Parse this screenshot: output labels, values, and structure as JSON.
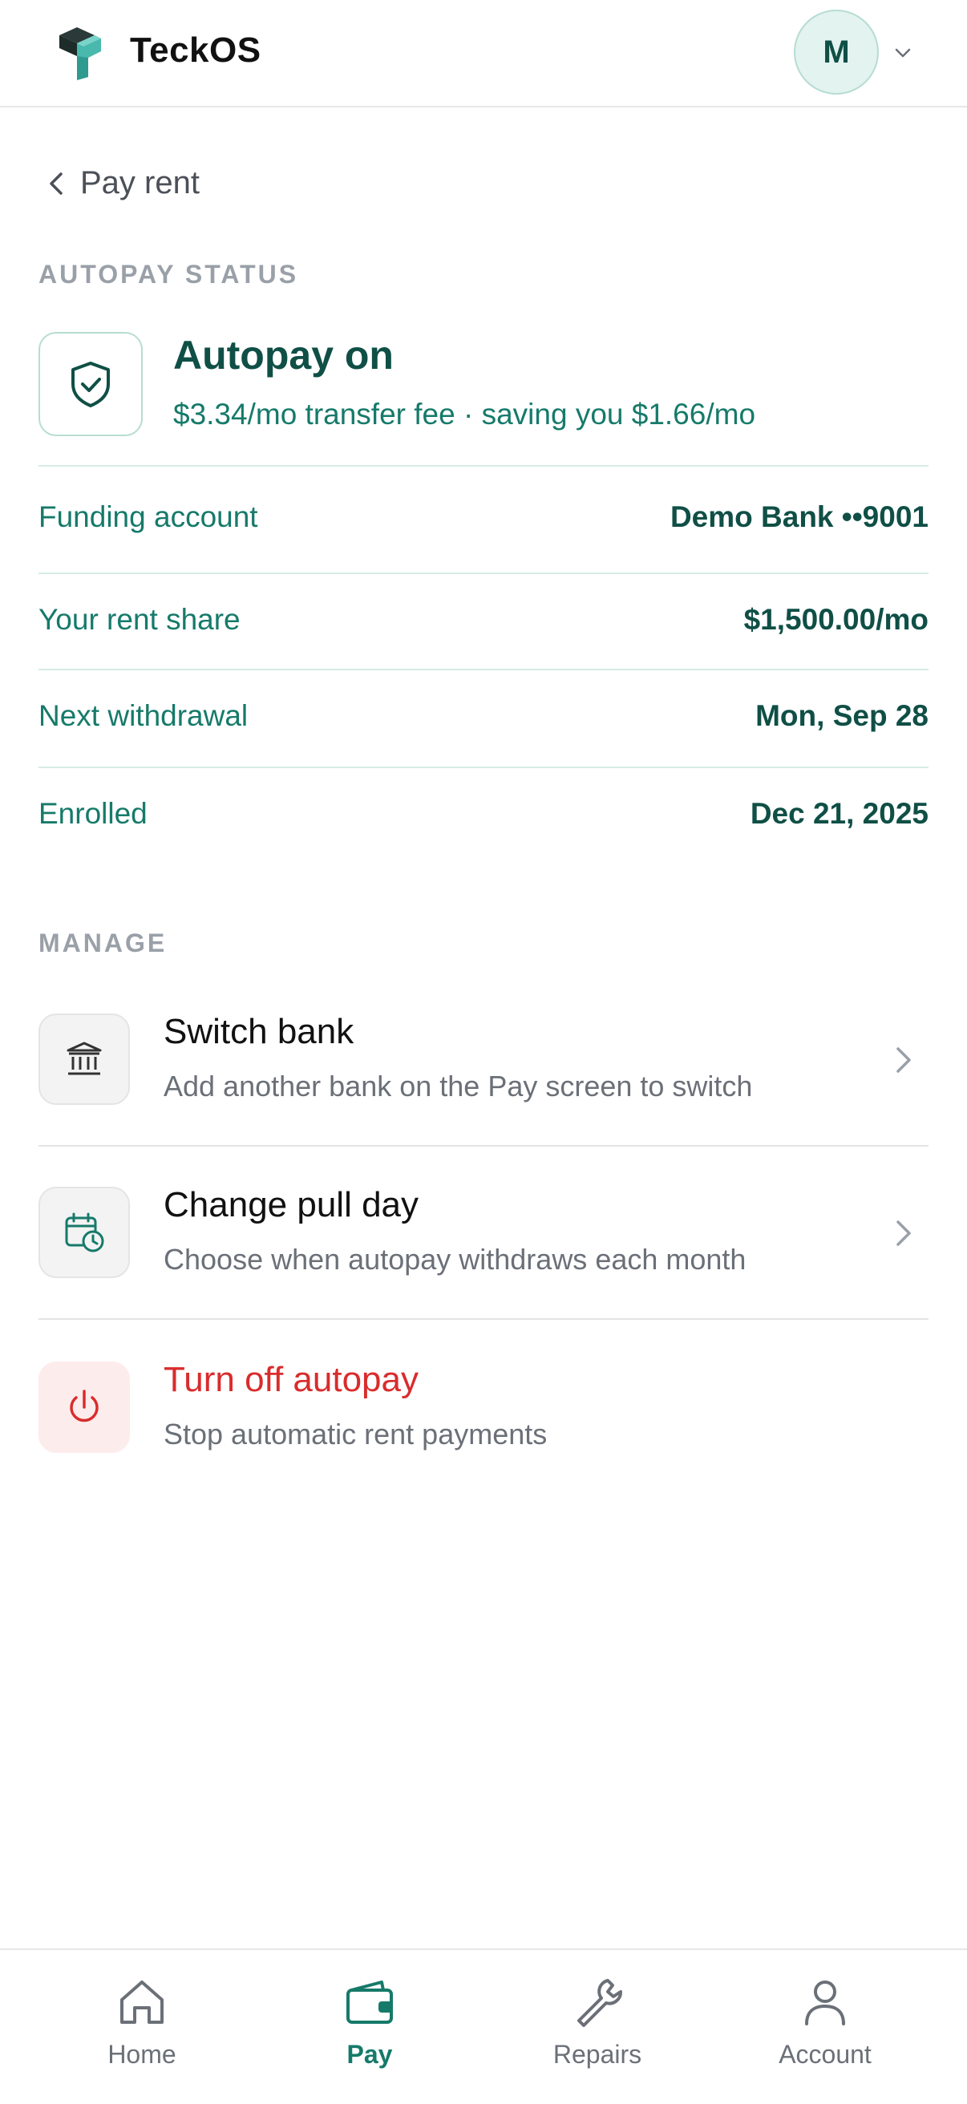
{
  "header": {
    "app_name": "TeckOS",
    "avatar_initial": "M"
  },
  "nav": {
    "back_label": "Pay rent"
  },
  "autopay_status": {
    "section_label": "AUTOPAY STATUS",
    "title": "Autopay on",
    "subtitle": "$3.34/mo transfer fee · saving you $1.66/mo",
    "details": [
      {
        "label": "Funding account",
        "value": "Demo Bank ••9001"
      },
      {
        "label": "Your rent share",
        "value": "$1,500.00/mo"
      },
      {
        "label": "Next withdrawal",
        "value": "Mon, Sep 28"
      },
      {
        "label": "Enrolled",
        "value": "Dec 21, 2025"
      }
    ]
  },
  "manage": {
    "section_label": "MANAGE",
    "items": [
      {
        "title": "Switch bank",
        "subtitle": "Add another bank on the Pay screen to switch",
        "icon": "bank-icon"
      },
      {
        "title": "Change pull day",
        "subtitle": "Choose when autopay withdraws each month",
        "icon": "calendar-clock-icon"
      },
      {
        "title": "Turn off autopay",
        "subtitle": "Stop automatic rent payments",
        "icon": "power-icon"
      }
    ]
  },
  "bottom_nav": {
    "items": [
      {
        "label": "Home",
        "icon": "home-icon"
      },
      {
        "label": "Pay",
        "icon": "wallet-icon",
        "active": true
      },
      {
        "label": "Repairs",
        "icon": "wrench-icon"
      },
      {
        "label": "Account",
        "icon": "user-icon"
      }
    ]
  },
  "colors": {
    "accent": "#167a6a",
    "accent_dark": "#0f4f46",
    "danger": "#d92c2c",
    "muted": "#6b7078"
  }
}
